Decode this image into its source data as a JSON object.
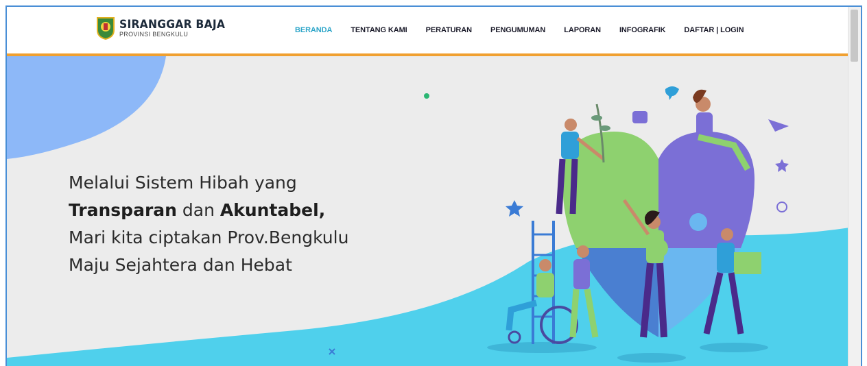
{
  "brand": {
    "title": "SIRANGGAR BAJA",
    "subtitle": "PROVINSI BENGKULU"
  },
  "nav": {
    "items": [
      {
        "label": "BERANDA",
        "active": true
      },
      {
        "label": "TENTANG KAMI",
        "active": false
      },
      {
        "label": "PERATURAN",
        "active": false
      },
      {
        "label": "PENGUMUMAN",
        "active": false
      },
      {
        "label": "LAPORAN",
        "active": false
      },
      {
        "label": "INFOGRAFIK",
        "active": false
      },
      {
        "label": "DAFTAR | LOGIN",
        "active": false
      }
    ]
  },
  "hero": {
    "line1": "Melalui Sistem Hibah yang",
    "line2_bold1": "Transparan",
    "line2_mid": " dan ",
    "line2_bold2": "Akuntabel,",
    "line3": "Mari kita ciptakan Prov.Bengkulu",
    "line4": "Maju Sejahtera dan Hebat"
  },
  "colors": {
    "accent": "#2fa6c9",
    "nav_border": "#f0a030",
    "wave": "#4fd0ec",
    "blob": "#8db8f8"
  }
}
